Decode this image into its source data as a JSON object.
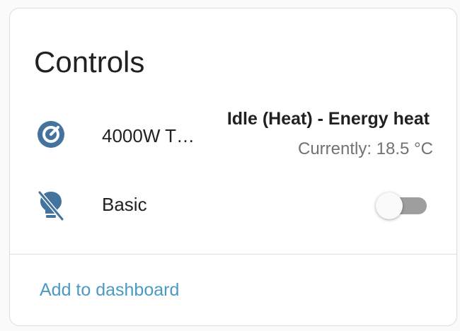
{
  "card": {
    "title": "Controls"
  },
  "rows": [
    {
      "icon": "thermostat-dial-icon",
      "name": "4000W T…",
      "state": "Idle (Heat) - Energy heat",
      "sub_state": "Currently: 18.5 °C"
    },
    {
      "icon": "lightbulb-off-icon",
      "name": "Basic",
      "toggle_on": false
    }
  ],
  "footer": {
    "action_label": "Add to dashboard"
  },
  "colors": {
    "icon": "#44739e",
    "link": "#4a9ac4",
    "toggle_off_track": "#9e9e9e"
  }
}
